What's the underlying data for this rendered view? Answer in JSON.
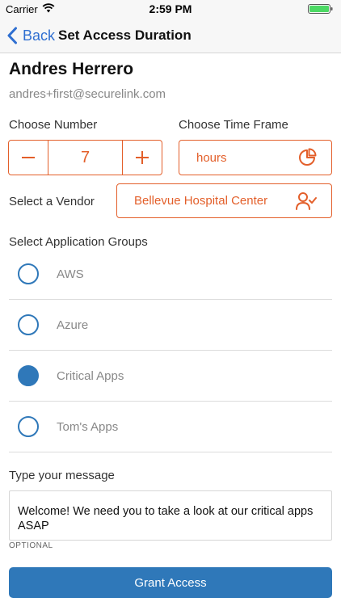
{
  "status_bar": {
    "carrier": "Carrier",
    "time": "2:59 PM"
  },
  "nav": {
    "back_label": "Back",
    "title": "Set Access Duration"
  },
  "user": {
    "name": "Andres Herrero",
    "email": "andres+first@securelink.com"
  },
  "number": {
    "label": "Choose Number",
    "value": "7"
  },
  "time_frame": {
    "label": "Choose Time Frame",
    "value": "hours",
    "icon": "pie-chart-icon"
  },
  "vendor": {
    "label": "Select a Vendor",
    "value": "Bellevue Hospital Center",
    "icon": "user-check-icon"
  },
  "app_groups": {
    "label": "Select Application Groups",
    "items": [
      {
        "label": "AWS",
        "selected": false
      },
      {
        "label": "Azure",
        "selected": false
      },
      {
        "label": "Critical Apps",
        "selected": true
      },
      {
        "label": "Tom's Apps",
        "selected": false
      }
    ]
  },
  "message": {
    "label": "Type your message",
    "value": "Welcome! We need you to take a look at our critical apps ASAP",
    "hint": "OPTIONAL"
  },
  "grant_button": {
    "label": "Grant Access"
  },
  "colors": {
    "accent": "#e35f2a",
    "primary": "#2f78b9",
    "ios_blue": "#2f6fd1",
    "battery": "#4cd964"
  }
}
